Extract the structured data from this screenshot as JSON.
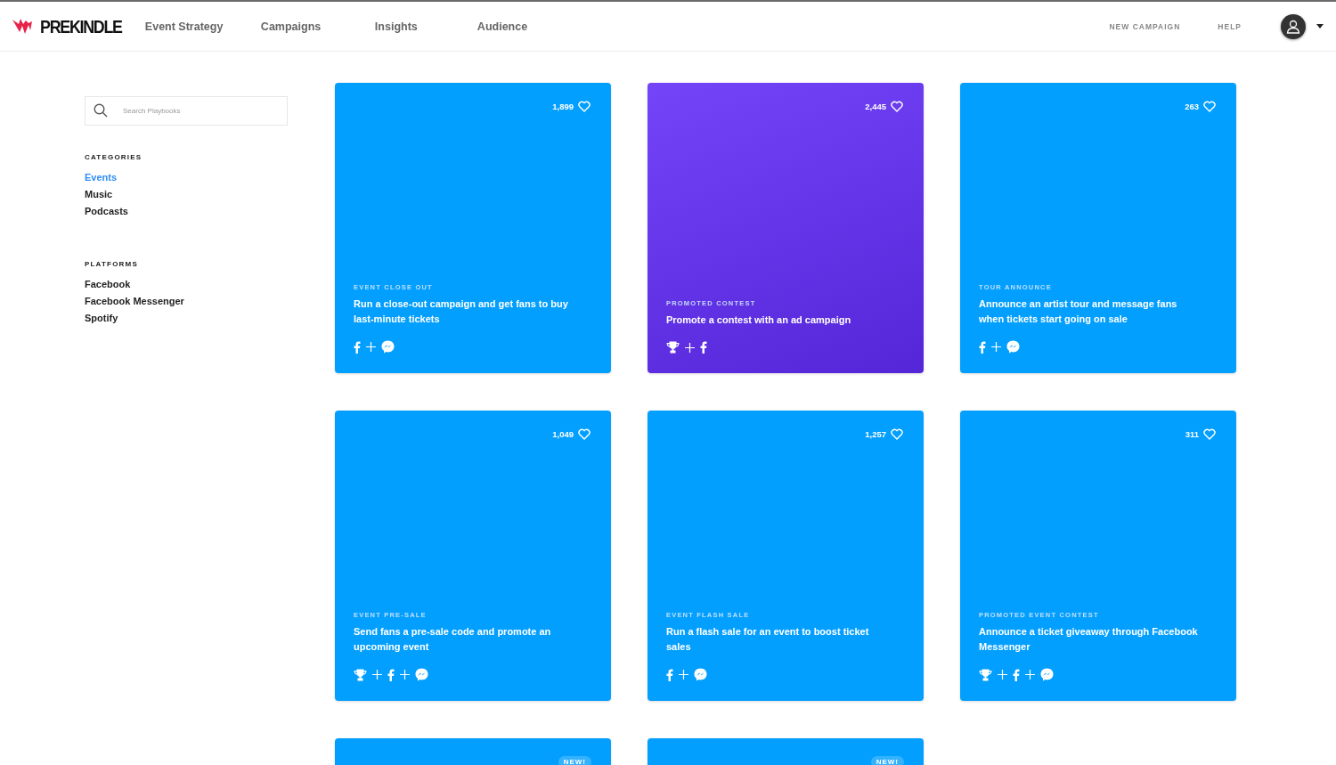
{
  "brand": "PREKINDLE",
  "nav": [
    {
      "label": "Event Strategy"
    },
    {
      "label": "Campaigns"
    },
    {
      "label": "Insights"
    },
    {
      "label": "Audience"
    }
  ],
  "actions": [
    {
      "label": "NEW CAMPAIGN"
    },
    {
      "label": "HELP"
    }
  ],
  "search": {
    "placeholder": "Search Playbooks"
  },
  "filters": [
    {
      "heading": "CATEGORIES",
      "items": [
        {
          "label": "Events",
          "selected": true
        },
        {
          "label": "Music",
          "selected": false
        },
        {
          "label": "Podcasts",
          "selected": false
        }
      ]
    },
    {
      "heading": "PLATFORMS",
      "items": [
        {
          "label": "Facebook",
          "selected": false
        },
        {
          "label": "Facebook Messenger",
          "selected": false
        },
        {
          "label": "Spotify",
          "selected": false
        }
      ]
    }
  ],
  "cards": [
    {
      "likes": "1,899",
      "category": "EVENT CLOSE OUT",
      "title": "Run a close-out campaign and get fans to buy last-minute tickets",
      "color": "#039ffe",
      "platforms": [
        {
          "kind": "facebook"
        },
        {
          "kind": "messenger"
        }
      ]
    },
    {
      "likes": "2,445",
      "category": "PROMOTED CONTEST",
      "title": "Promote a contest with an ad campaign",
      "color": "#7445f8",
      "platforms": [
        {
          "kind": "trophy"
        },
        {
          "kind": "facebook"
        }
      ]
    },
    {
      "likes": "263",
      "category": "TOUR ANNOUNCE",
      "title": "Announce an artist tour and message fans when tickets start going on sale",
      "color": "#039ffe",
      "platforms": [
        {
          "kind": "facebook"
        },
        {
          "kind": "messenger"
        }
      ]
    },
    {
      "likes": "1,049",
      "category": "EVENT PRE-SALE",
      "title": "Send fans a pre-sale code and promote an upcoming event",
      "color": "#039ffe",
      "platforms": [
        {
          "kind": "trophy"
        },
        {
          "kind": "facebook"
        },
        {
          "kind": "messenger"
        }
      ]
    },
    {
      "likes": "1,257",
      "category": "EVENT FLASH SALE",
      "title": "Run a flash sale for an event to boost ticket sales",
      "color": "#039ffe",
      "platforms": [
        {
          "kind": "facebook"
        },
        {
          "kind": "messenger"
        }
      ]
    },
    {
      "likes": "311",
      "category": "PROMOTED EVENT CONTEST",
      "title": "Announce a ticket giveaway through Facebook Messenger",
      "color": "#039ffe",
      "platforms": [
        {
          "kind": "trophy"
        },
        {
          "kind": "facebook"
        },
        {
          "kind": "messenger"
        }
      ]
    },
    {
      "badge": "NEW!",
      "color": "#039ffe"
    },
    {
      "badge": "NEW!",
      "color": "#039ffe"
    }
  ]
}
